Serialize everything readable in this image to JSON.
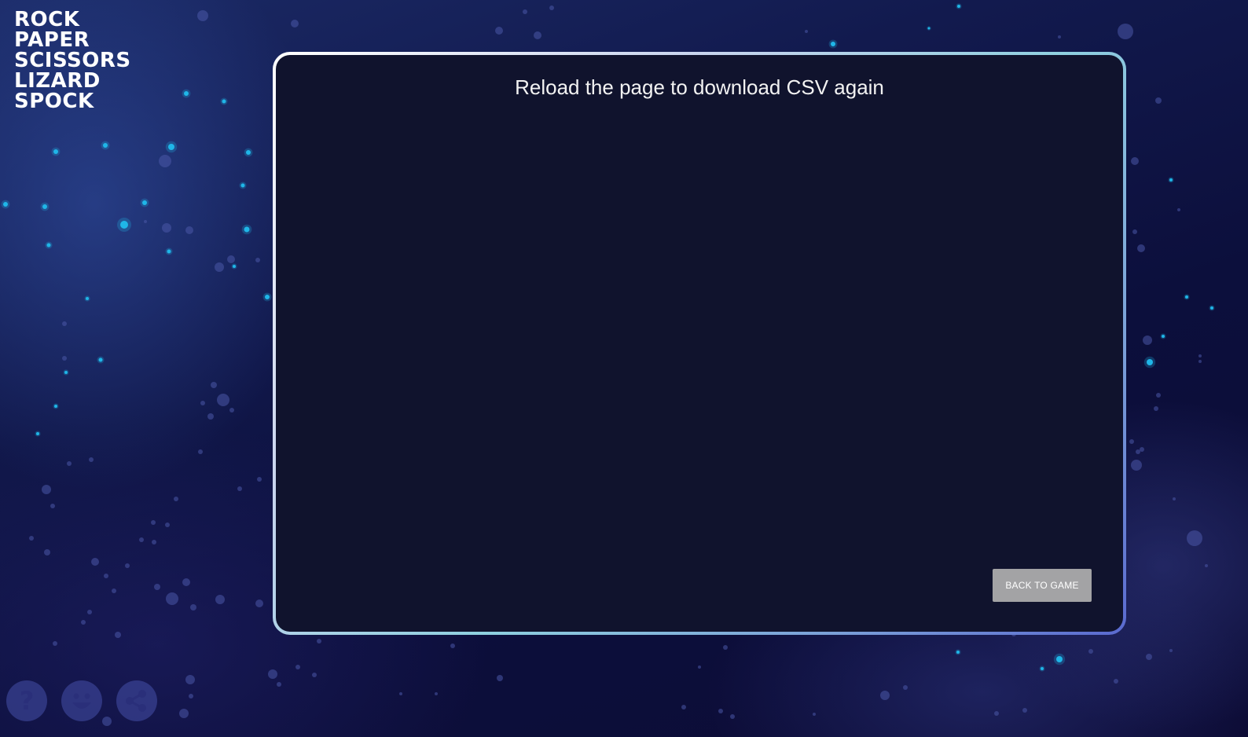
{
  "logo": {
    "lines": [
      "ROCK",
      "PAPER",
      "SCISSORS",
      "LIZARD",
      "SPOCK"
    ]
  },
  "panel": {
    "title": "Reload the page to download CSV again",
    "back_button_label": "BACK TO GAME"
  },
  "bottom_icons": [
    {
      "name": "help-icon"
    },
    {
      "name": "smiley-icon"
    },
    {
      "name": "share-icon"
    }
  ],
  "colors": {
    "panel_background": "#10132d",
    "button_background": "#a3a3a5",
    "star_cyan": "#1fb6e8"
  }
}
